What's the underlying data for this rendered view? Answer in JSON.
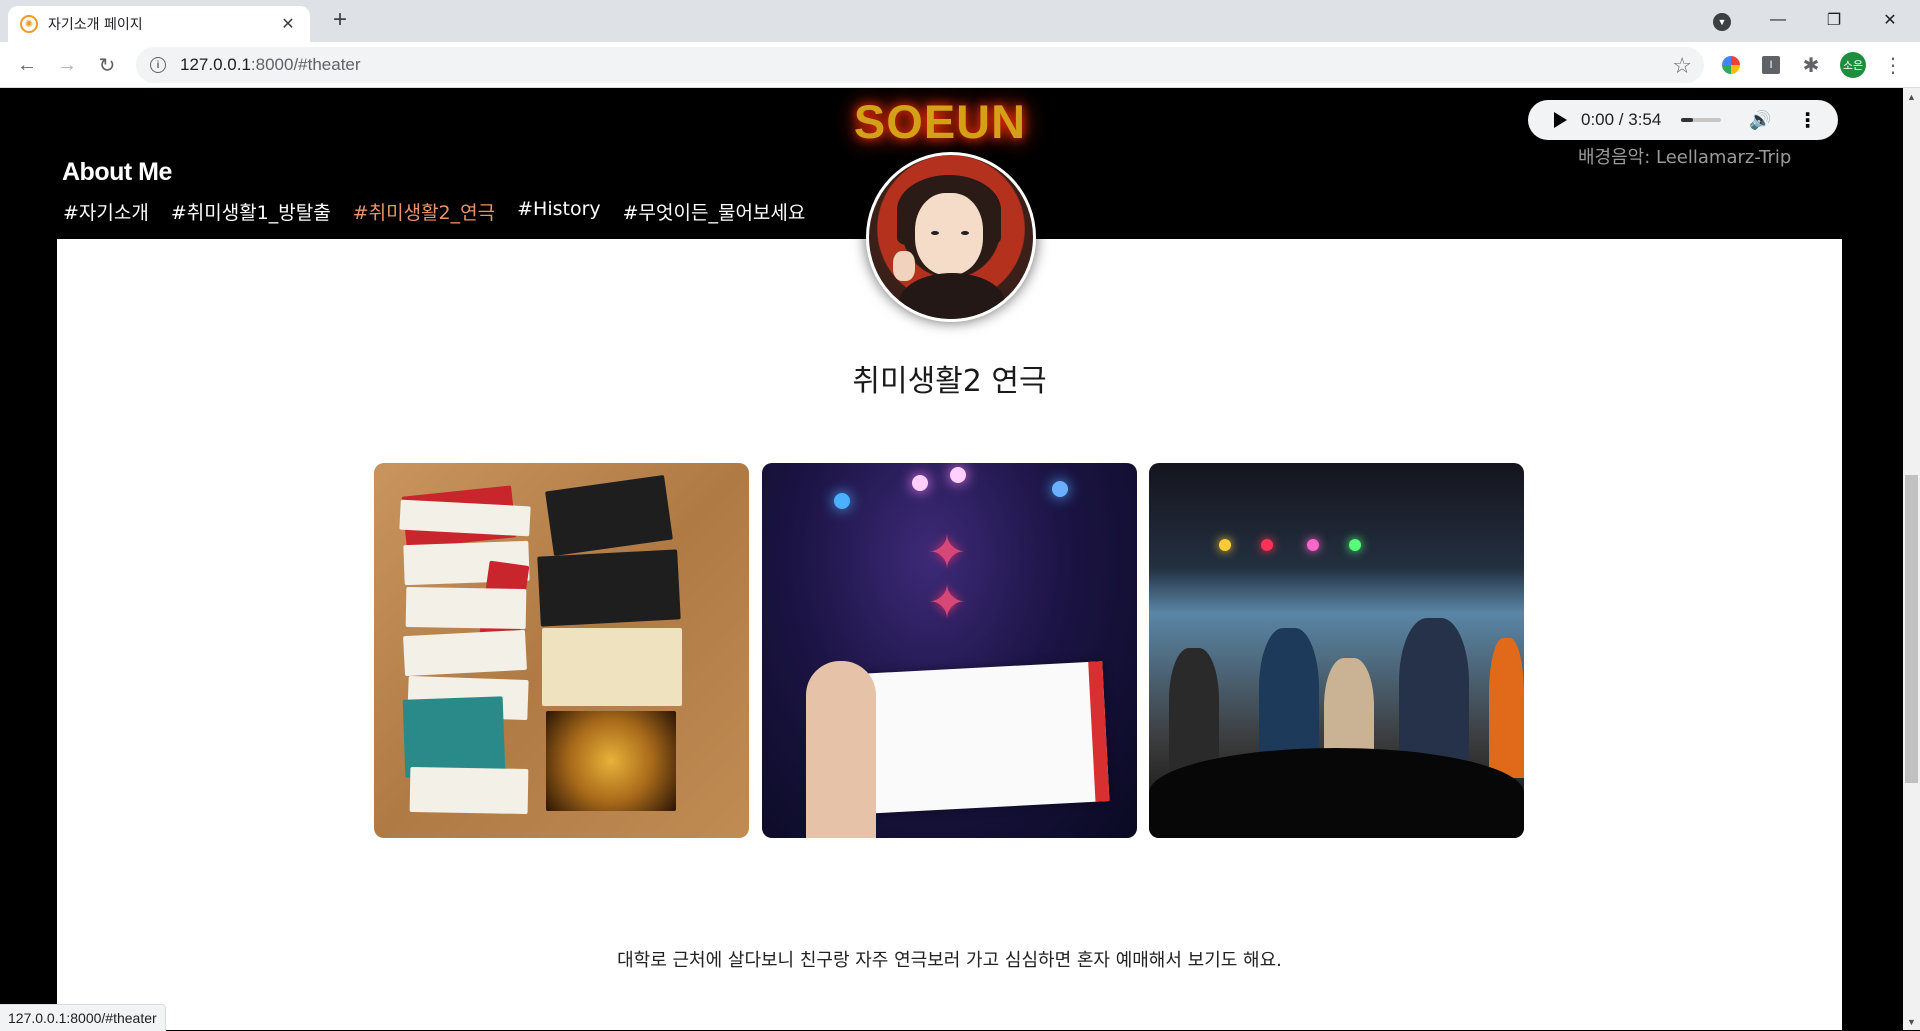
{
  "browser": {
    "tab_title": "자기소개 페이지",
    "url_host": "127.0.0.1",
    "url_rest": ":8000/#theater",
    "profile_initials": "소은",
    "status_url": "127.0.0.1:8000/#theater"
  },
  "header": {
    "brand": "SOEUN",
    "about": "About Me",
    "nav": [
      {
        "label": "#자기소개",
        "active": false
      },
      {
        "label": "#취미생활1_방탈출",
        "active": false
      },
      {
        "label": "#취미생활2_연극",
        "active": true
      },
      {
        "label": "#History",
        "active": false
      },
      {
        "label": "#무엇이든_물어보세요",
        "active": false
      }
    ]
  },
  "audio": {
    "time": "0:00 / 3:54",
    "progress": 0.3,
    "caption": "배경음악: Leellamarz-Trip"
  },
  "section": {
    "title": "취미생활2 연극",
    "photos": [
      "ticket-collection-photo",
      "theater-ticket-photo",
      "stage-actors-photo"
    ],
    "caption": "대학로 근처에 살다보니 친구랑 자주 연극보러 가고 심심하면 혼자 예매해서 보기도 해요."
  }
}
